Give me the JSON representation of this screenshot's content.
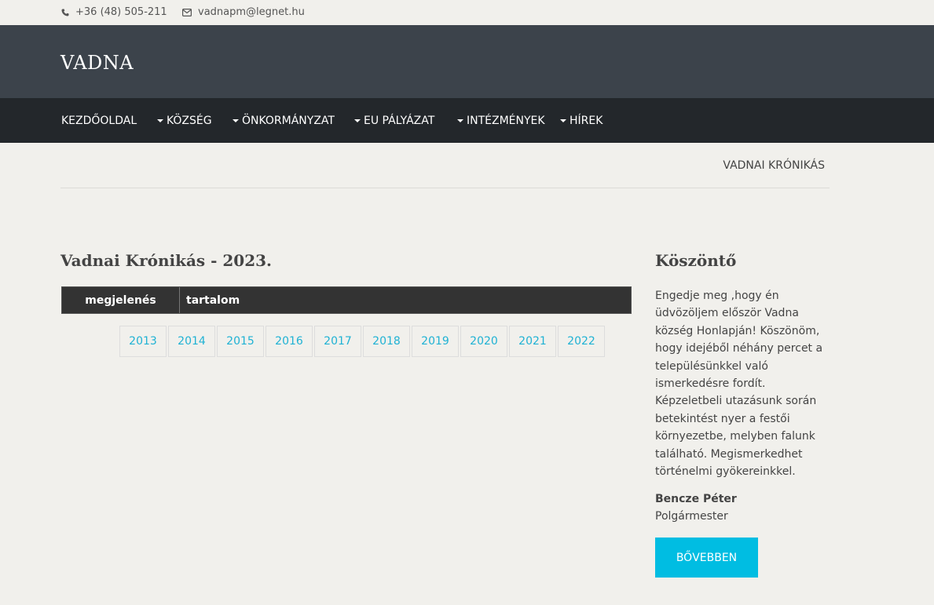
{
  "topbar": {
    "phone": "+36 (48) 505-211",
    "email": "vadnapm@legnet.hu"
  },
  "header": {
    "brand": "VADNA"
  },
  "nav": {
    "items": [
      {
        "label": "KEZDŐOLDAL",
        "has_caret": false
      },
      {
        "label": "KÖZSÉG",
        "has_caret": true
      },
      {
        "label": "ÖNKORMÁNYZAT",
        "has_caret": true
      },
      {
        "label": "EU PÁLYÁZAT",
        "has_caret": true
      },
      {
        "label": "INTÉZMÉNYEK",
        "has_caret": true
      },
      {
        "label": "HÍREK",
        "has_caret": true
      }
    ]
  },
  "breadcrumb": "VADNAI KRÓNIKÁS",
  "main": {
    "title": "Vadnai Krónikás - 2023.",
    "table_headers": [
      "megjelenés",
      "tartalom"
    ],
    "years": [
      "2013",
      "2014",
      "2015",
      "2016",
      "2017",
      "2018",
      "2019",
      "2020",
      "2021",
      "2022"
    ]
  },
  "sidebar": {
    "title": "Köszöntő",
    "text": "Engedje meg ,hogy én üdvözöljem először Vadna község Honlapján! Köszönöm, hogy idejéből néhány percet a településünkkel való ismerkedésre fordít. Képzeletbeli utazásunk során betekintést nyer a festői környezetbe, melyben falunk található. Megismerkedhet történelmi gyökereinkkel.",
    "name": "Bencze Péter",
    "role": "Polgármester",
    "button": "BŐVEBBEN"
  },
  "colors": {
    "header_bg": "#3c434b",
    "nav_bg": "#23272b",
    "accent": "#00bde2",
    "link": "#1fb2d4",
    "page_bg": "#f1f0ec"
  }
}
